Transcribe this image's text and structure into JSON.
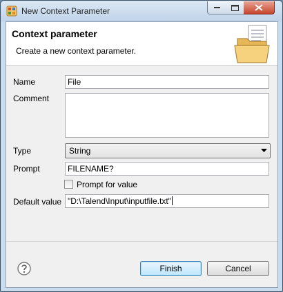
{
  "window": {
    "title": "New Context Parameter"
  },
  "header": {
    "title": "Context parameter",
    "subtitle": "Create a new context parameter."
  },
  "form": {
    "name_label": "Name",
    "name_value": "File",
    "comment_label": "Comment",
    "comment_value": "",
    "type_label": "Type",
    "type_value": "String",
    "prompt_label": "Prompt",
    "prompt_value": "FILENAME?",
    "prompt_for_value_label": "Prompt for value",
    "prompt_for_value_checked": false,
    "default_label": "Default value",
    "default_value": "\"D:\\Talend\\Input\\inputfile.txt\""
  },
  "footer": {
    "finish_label": "Finish",
    "cancel_label": "Cancel"
  },
  "colors": {
    "accent": "#3c7fb1",
    "close_button": "#c7442c"
  }
}
